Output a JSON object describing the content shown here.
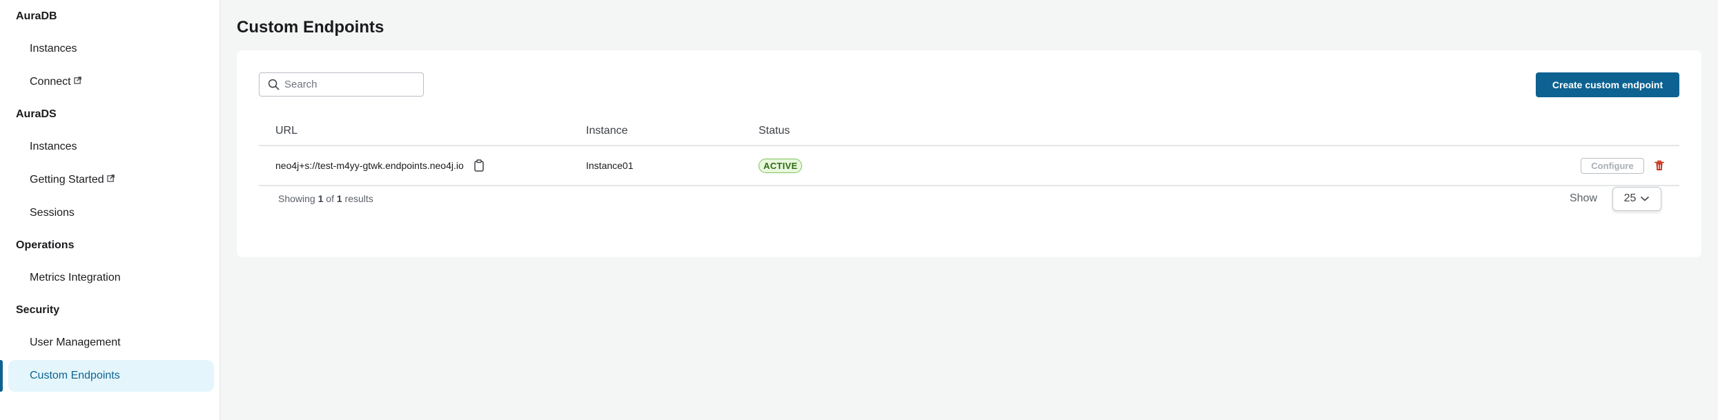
{
  "sidebar": {
    "sections": [
      {
        "title": "AuraDB",
        "items": [
          {
            "label": "Instances",
            "external": false
          },
          {
            "label": "Connect",
            "external": true
          }
        ]
      },
      {
        "title": "AuraDS",
        "items": [
          {
            "label": "Instances",
            "external": false
          },
          {
            "label": "Getting Started",
            "external": true
          },
          {
            "label": "Sessions",
            "external": false
          }
        ]
      },
      {
        "title": "Operations",
        "items": [
          {
            "label": "Metrics Integration",
            "external": false
          }
        ]
      },
      {
        "title": "Security",
        "items": [
          {
            "label": "User Management",
            "external": false
          },
          {
            "label": "Custom Endpoints",
            "external": false,
            "active": true
          }
        ]
      }
    ]
  },
  "main": {
    "title": "Custom Endpoints",
    "search": {
      "placeholder": "Search",
      "value": ""
    },
    "create_button": "Create custom endpoint",
    "table": {
      "columns": [
        "URL",
        "Instance",
        "Status"
      ],
      "rows": [
        {
          "url": "neo4j+s://test-m4yy-gtwk.endpoints.neo4j.io",
          "instance": "Instance01",
          "status": "ACTIVE",
          "configure_label": "Configure"
        }
      ]
    },
    "footer": {
      "showing_prefix": "Showing",
      "showing_from": "1",
      "showing_of": "of",
      "showing_total": "1",
      "showing_suffix": "results",
      "show_label": "Show",
      "page_size": "25"
    }
  },
  "colors": {
    "accent": "#0d6291",
    "active_nav_bg": "#e4f6fb",
    "status_active_bg": "#e8f7dd",
    "status_active_border": "#7cc45a",
    "danger": "#c8321a"
  },
  "icons": {
    "search": "search-icon",
    "external_link": "external-link-icon",
    "copy": "clipboard-icon",
    "delete": "trash-icon",
    "dropdown": "chevron-down-icon"
  }
}
